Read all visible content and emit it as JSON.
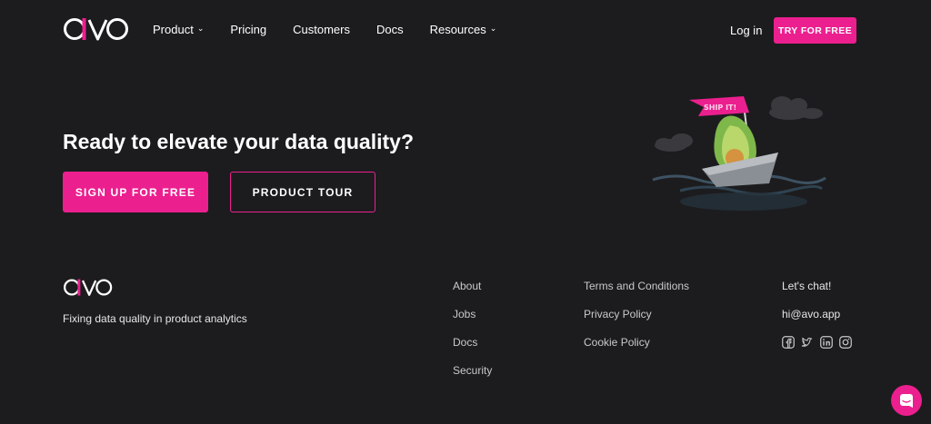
{
  "brand": {
    "logo_text": "avo",
    "accent_color": "#ec1f8f",
    "background_color": "#1c1c1e"
  },
  "nav": {
    "items": [
      {
        "label": "Product",
        "has_dropdown": true
      },
      {
        "label": "Pricing",
        "has_dropdown": false
      },
      {
        "label": "Customers",
        "has_dropdown": false
      },
      {
        "label": "Docs",
        "has_dropdown": false
      },
      {
        "label": "Resources",
        "has_dropdown": true
      }
    ],
    "login_label": "Log in",
    "cta_label": "TRY FOR FREE"
  },
  "hero": {
    "headline": "Ready to elevate your data quality?",
    "primary_button": "SIGN UP FOR FREE",
    "secondary_button": "PRODUCT TOUR",
    "illustration": {
      "flag_text": "SHIP IT!"
    }
  },
  "footer": {
    "tagline": "Fixing data quality in product analytics",
    "column1": [
      "About",
      "Jobs",
      "Docs",
      "Security"
    ],
    "column2": [
      "Terms and Conditions",
      "Privacy Policy",
      "Cookie Policy"
    ],
    "contact": {
      "heading": "Let's chat!",
      "email": "hi@avo.app"
    },
    "social_icons": [
      "facebook-icon",
      "twitter-icon",
      "linkedin-icon",
      "instagram-icon"
    ]
  },
  "widgets": {
    "chat_icon": "intercom-chat-icon"
  }
}
